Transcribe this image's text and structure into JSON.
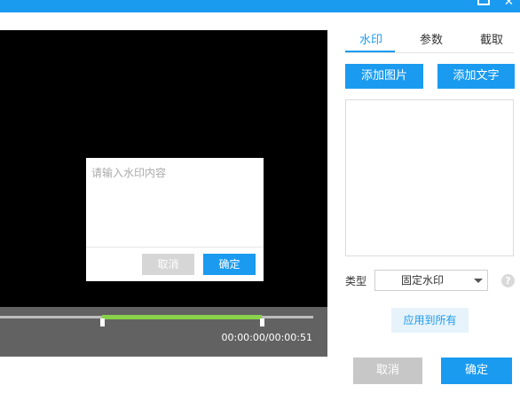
{
  "window": {
    "maximize_icon": "maximize-icon",
    "close_icon": "close-icon",
    "close_glyph": "✕"
  },
  "player": {
    "time": "00:00:00/00:00:51",
    "clip_start_fraction": 0.325,
    "clip_end_fraction": 0.835
  },
  "dialog": {
    "placeholder": "请输入水印内容",
    "cancel_label": "取消",
    "ok_label": "确定"
  },
  "tabs": [
    {
      "label": "水印",
      "active": true
    },
    {
      "label": "参数",
      "active": false
    },
    {
      "label": "截取",
      "active": false
    }
  ],
  "panel": {
    "add_image_label": "添加图片",
    "add_text_label": "添加文字",
    "type_label": "类型",
    "type_value": "固定水印",
    "help_glyph": "?",
    "apply_all_label": "应用到所有"
  },
  "footer": {
    "cancel_label": "取消",
    "ok_label": "确定"
  },
  "colors": {
    "accent": "#1a9bf0",
    "progress": "#8ad24a",
    "disabled": "#c7c7c7"
  }
}
